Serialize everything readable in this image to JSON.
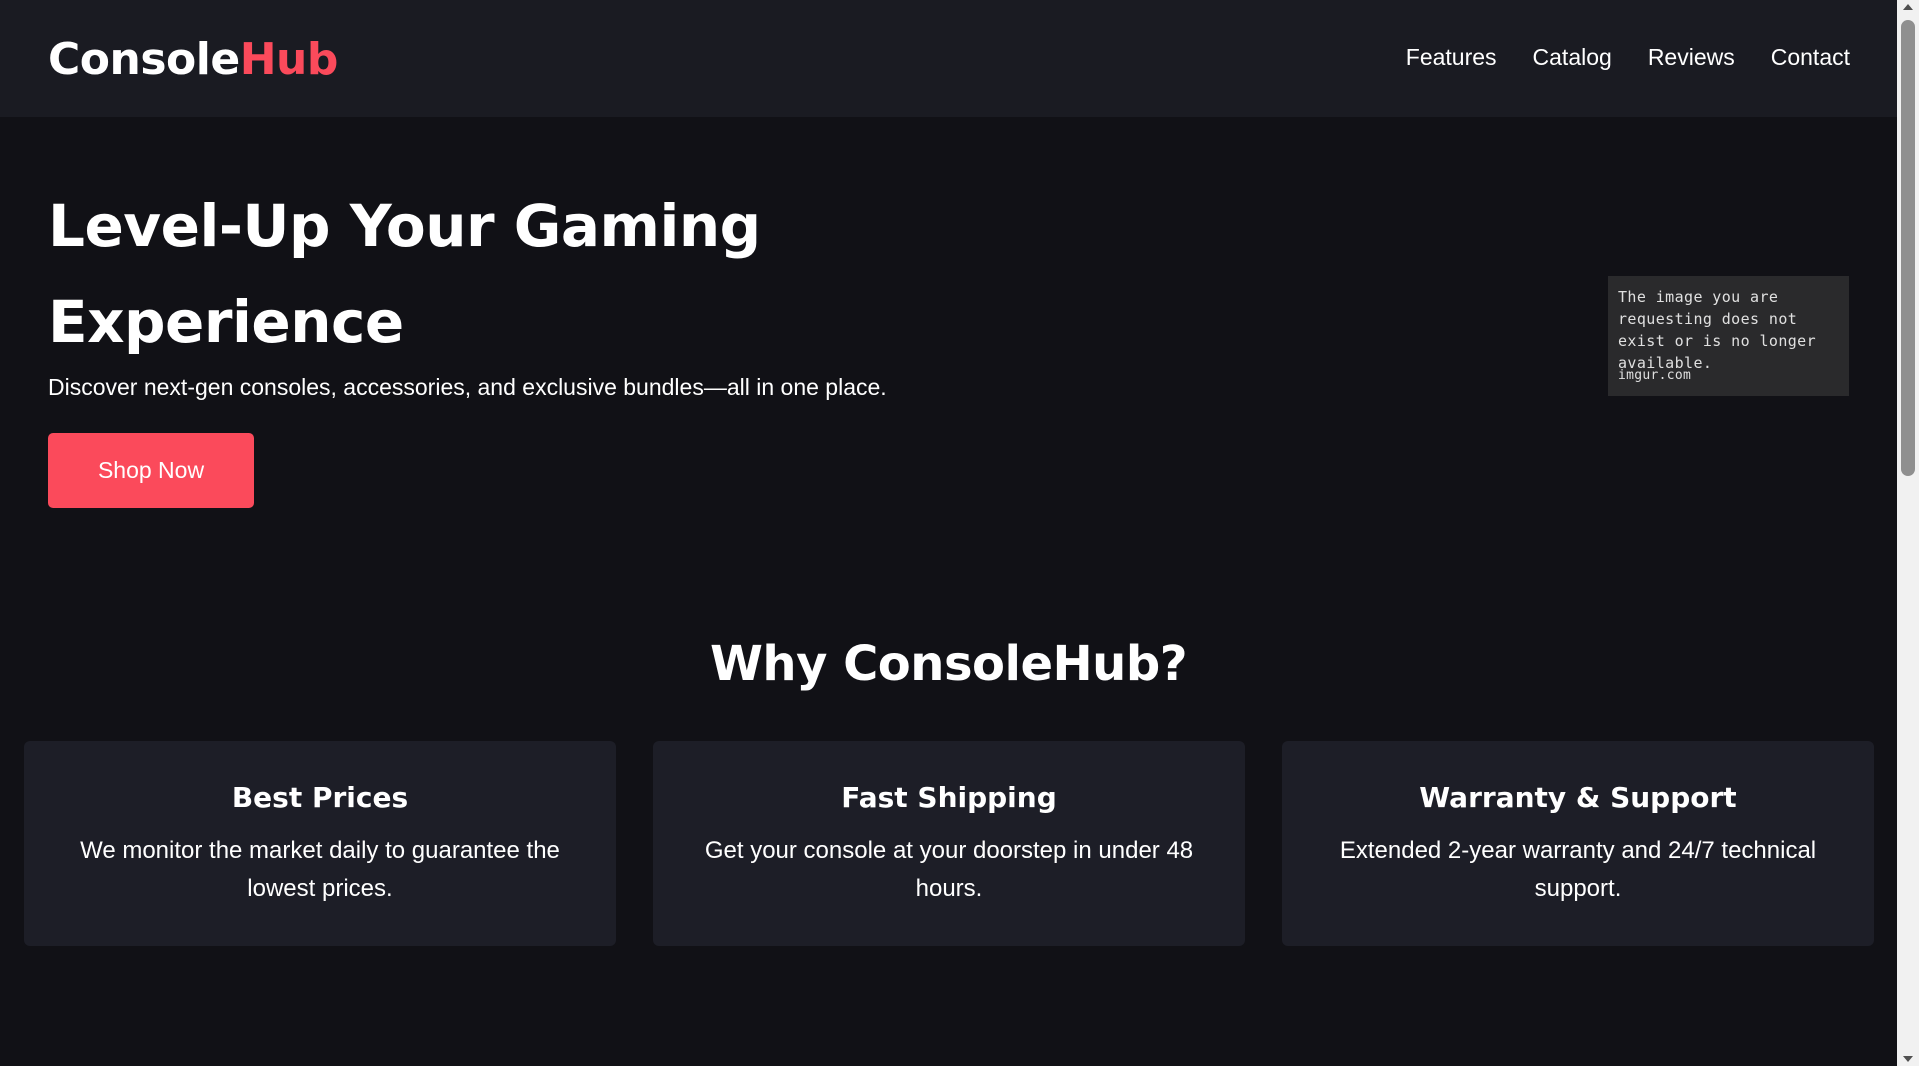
{
  "header": {
    "logo_main": "Console",
    "logo_accent": "Hub",
    "nav": [
      "Features",
      "Catalog",
      "Reviews",
      "Contact"
    ]
  },
  "hero": {
    "title_line1": "Level-Up Your Gaming",
    "title_line2": "Experience",
    "subtitle": "Discover next-gen consoles, accessories, and exclusive bundles—all in one place.",
    "cta_label": "Shop Now",
    "image_placeholder": {
      "message": "The image you are requesting does not exist or is no longer available.",
      "source": "imgur.com"
    }
  },
  "features": {
    "heading": "Why ConsoleHub?",
    "cards": [
      {
        "title": "Best Prices",
        "text": "We monitor the market daily to guarantee the lowest prices."
      },
      {
        "title": "Fast Shipping",
        "text": "Get your console at your doorstep in under 48 hours."
      },
      {
        "title": "Warranty & Support",
        "text": "Extended 2-year warranty and 24/7 technical support."
      }
    ]
  },
  "colors": {
    "accent": "#fb4a5b",
    "background": "#111116",
    "header_bg": "#1a1b22",
    "card_bg": "#1d1e27"
  }
}
